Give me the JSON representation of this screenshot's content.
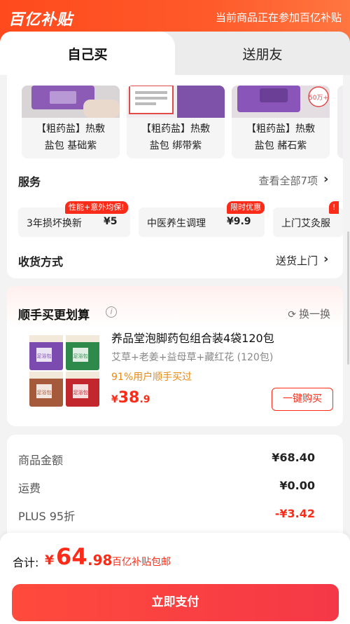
{
  "banner": {
    "brand": "百亿补贴",
    "note": "当前商品正在参加百亿补贴"
  },
  "tabs": [
    {
      "label": "自己买",
      "active": true
    },
    {
      "label": "送朋友",
      "active": false
    }
  ],
  "variants": [
    {
      "label_line1": "【粗药盐】热敷",
      "label_line2": "盐包 基础紫"
    },
    {
      "label_line1": "【粗药盐】热敷",
      "label_line2": "盐包 绑带紫"
    },
    {
      "label_line1": "【粗药盐】热敷",
      "label_line2": "盐包 赭石紫"
    }
  ],
  "variant_badge": "50万+",
  "services": {
    "title": "服务",
    "view_all": "查看全部7项",
    "items": [
      {
        "name": "3年损坏换新",
        "price": "¥5",
        "badge": "性能+意外均保!"
      },
      {
        "name": "中医养生调理",
        "price": "¥9.9",
        "badge": "限时优惠"
      },
      {
        "name": "上门艾灸服",
        "price": "",
        "badge": "!"
      }
    ]
  },
  "shipping": {
    "title": "收货方式",
    "value": "送货上门"
  },
  "bundle": {
    "title": "顺手买更划算",
    "info_icon": "i",
    "swap_label": "换一换",
    "product_name": "养品堂泡脚药包组合装4袋120包",
    "product_sub": "艾草+老姜+益母草+藏红花 (120包)",
    "stat": "91%用户顺手买过",
    "price_symbol": "¥",
    "price_int": "38",
    "price_dec": ".9",
    "buy_label": "一键购买",
    "packs": [
      {
        "color": "#7c4bb0",
        "text": "足浴包"
      },
      {
        "color": "#2e8a4a",
        "text": "足浴包"
      },
      {
        "color": "#a55a3b",
        "text": "足浴包"
      },
      {
        "color": "#c1272d",
        "text": "足浴包"
      }
    ]
  },
  "price_summary": {
    "rows": [
      {
        "label": "商品金额",
        "value": "¥68.40",
        "red": false
      },
      {
        "label": "运费",
        "value": "¥0.00",
        "red": false
      },
      {
        "label": "PLUS 95折",
        "value": "-¥3.42",
        "red": true
      }
    ]
  },
  "bottom": {
    "total_label": "合计:",
    "total_symbol": "¥",
    "total_int": "64",
    "total_dec": ".98",
    "total_note": "百亿补贴包邮",
    "pay_label": "立即支付"
  },
  "colors": {
    "brand_red": "#fa2c19",
    "banner": "#ff4a1d",
    "accent_orange": "#e88a13"
  }
}
